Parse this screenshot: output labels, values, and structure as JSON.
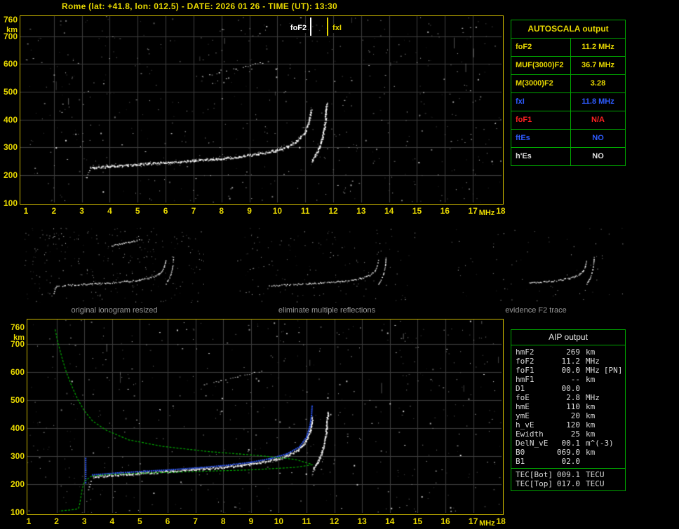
{
  "header": {
    "title": "Rome (lat: +41.8, lon: 012.5) - DATE: 2026 01 26 - TIME (UT): 13:30"
  },
  "colors": {
    "yellow": "#e8d800",
    "green_border": "#00a800",
    "blue": "#2e5bff",
    "red": "#ff2222",
    "white": "#e0e0e0",
    "profile_green": "#00b400",
    "caption_gray": "#9a9a9a"
  },
  "autoscala": {
    "title": "AUTOSCALA output",
    "rows": [
      {
        "label": "foF2",
        "value": "11.2 MHz",
        "color": "#e8d800"
      },
      {
        "label": "MUF(3000)F2",
        "value": "36.7 MHz",
        "color": "#e8d800"
      },
      {
        "label": "M(3000)F2",
        "value": "3.28",
        "color": "#e8d800"
      },
      {
        "label": "fxI",
        "value": "11.8 MHz",
        "color": "#2e5bff"
      },
      {
        "label": "foF1",
        "value": "N/A",
        "color": "#ff2222"
      },
      {
        "label": "ftEs",
        "value": "NO",
        "color": "#2e5bff"
      },
      {
        "label": "h'Es",
        "value": "NO",
        "color": "#e0e0e0"
      }
    ]
  },
  "aip": {
    "title": "AIP output",
    "rows": [
      {
        "name": "hmF2",
        "value": "269",
        "unit": "km"
      },
      {
        "name": "foF2",
        "value": "11.2",
        "unit": "MHz"
      },
      {
        "name": "foF1",
        "value": "00.0",
        "unit": "MHz",
        "note": "[PN]"
      },
      {
        "name": "hmF1",
        "value": "--",
        "unit": "km"
      },
      {
        "name": "D1",
        "value": "00.0",
        "unit": ""
      },
      {
        "name": "foE",
        "value": "2.8",
        "unit": "MHz"
      },
      {
        "name": "hmE",
        "value": "110",
        "unit": "km"
      },
      {
        "name": "ymE",
        "value": "20",
        "unit": "km"
      },
      {
        "name": "h_vE",
        "value": "120",
        "unit": "km"
      },
      {
        "name": "Ewidth",
        "value": "25",
        "unit": "km"
      },
      {
        "name": "DelN_vE",
        "value": "00.1",
        "unit": "m^(-3)"
      },
      {
        "name": "B0",
        "value": "069.0",
        "unit": "km"
      },
      {
        "name": "B1",
        "value": "02.0",
        "unit": ""
      }
    ],
    "tec_rows": [
      {
        "name": "TEC[Bot]",
        "value": "009.1",
        "unit": "TECU"
      },
      {
        "name": "TEC[Top]",
        "value": "017.0",
        "unit": "TECU"
      }
    ]
  },
  "thumbnails": [
    {
      "caption": "original ionogram resized"
    },
    {
      "caption": "eliminate multiple reflections"
    },
    {
      "caption": "evidence F2 trace"
    }
  ],
  "chart_data": [
    {
      "id": "ionogram_top",
      "type": "scatter",
      "title": "Recorded ionogram with AUTOSCALA frequency markers",
      "xlabel": "MHz",
      "ylabel": "km",
      "xlim": [
        1,
        18
      ],
      "ylim": [
        100,
        760
      ],
      "xticks": [
        1,
        2,
        3,
        4,
        5,
        6,
        7,
        8,
        9,
        10,
        11,
        12,
        13,
        14,
        15,
        16,
        17,
        18
      ],
      "yticks": [
        760,
        700,
        600,
        500,
        400,
        300,
        200,
        100
      ],
      "grid": true,
      "legend": "none",
      "markers": [
        {
          "label": "foF2",
          "x": 11.2,
          "color": "#ffffff",
          "side": "left"
        },
        {
          "label": "fxI",
          "x": 11.8,
          "color": "#e8d800",
          "side": "right"
        }
      ],
      "traces": [
        {
          "name": "F2 ordinary trace",
          "color": "#ffffff",
          "style": "fuzzy",
          "points": [
            [
              3.3,
              228
            ],
            [
              3.9,
              233
            ],
            [
              4.6,
              238
            ],
            [
              5.4,
              243
            ],
            [
              6.2,
              248
            ],
            [
              7.0,
              254
            ],
            [
              7.8,
              260
            ],
            [
              8.6,
              268
            ],
            [
              9.3,
              278
            ],
            [
              9.9,
              290
            ],
            [
              10.35,
              305
            ],
            [
              10.7,
              325
            ],
            [
              10.95,
              352
            ],
            [
              11.1,
              388
            ],
            [
              11.17,
              420
            ],
            [
              11.2,
              438
            ]
          ]
        },
        {
          "name": "F2 extraordinary trace",
          "color": "#ffffff",
          "style": "fuzzy",
          "points": [
            [
              11.22,
              250
            ],
            [
              11.35,
              272
            ],
            [
              11.48,
              298
            ],
            [
              11.58,
              330
            ],
            [
              11.66,
              366
            ],
            [
              11.71,
              402
            ],
            [
              11.74,
              440
            ],
            [
              11.75,
              458
            ]
          ]
        },
        {
          "name": "second hop reflection",
          "color": "#ffffff",
          "style": "dotted",
          "points": [
            [
              7.3,
              556
            ],
            [
              7.9,
              570
            ],
            [
              8.5,
              584
            ],
            [
              9.1,
              598
            ],
            [
              9.45,
              606
            ]
          ]
        },
        {
          "name": "fmin cluster",
          "color": "#ffffff",
          "style": "dotted",
          "points": [
            [
              3.1,
              172
            ],
            [
              3.16,
              192
            ],
            [
              3.22,
              210
            ],
            [
              3.3,
              226
            ]
          ]
        }
      ]
    },
    {
      "id": "ionogram_bottom",
      "type": "scatter",
      "title": "Ionogram with autoscaled trace and electron density profile",
      "xlabel": "MHz",
      "ylabel": "km",
      "xlim": [
        1,
        18
      ],
      "ylim": [
        100,
        760
      ],
      "xticks": [
        1,
        2,
        3,
        4,
        5,
        6,
        7,
        8,
        9,
        10,
        11,
        12,
        13,
        14,
        15,
        16,
        17,
        18
      ],
      "yticks": [
        760,
        700,
        600,
        500,
        400,
        300,
        200,
        100
      ],
      "grid": true,
      "legend": "none",
      "markers": [],
      "traces": [
        {
          "name": "F2 ordinary trace",
          "color": "#ffffff",
          "style": "fuzzy",
          "points": [
            [
              3.3,
              228
            ],
            [
              3.9,
              233
            ],
            [
              4.6,
              238
            ],
            [
              5.4,
              243
            ],
            [
              6.2,
              248
            ],
            [
              7.0,
              254
            ],
            [
              7.8,
              260
            ],
            [
              8.6,
              268
            ],
            [
              9.3,
              278
            ],
            [
              9.9,
              290
            ],
            [
              10.35,
              305
            ],
            [
              10.7,
              325
            ],
            [
              10.95,
              352
            ],
            [
              11.1,
              388
            ],
            [
              11.17,
              420
            ],
            [
              11.2,
              438
            ]
          ]
        },
        {
          "name": "F2 extraordinary trace",
          "color": "#ffffff",
          "style": "fuzzy",
          "points": [
            [
              11.22,
              250
            ],
            [
              11.35,
              272
            ],
            [
              11.48,
              298
            ],
            [
              11.58,
              330
            ],
            [
              11.66,
              366
            ],
            [
              11.71,
              402
            ],
            [
              11.74,
              440
            ],
            [
              11.75,
              458
            ]
          ]
        },
        {
          "name": "second hop reflection",
          "color": "#ffffff",
          "style": "dotted",
          "points": [
            [
              7.3,
              556
            ],
            [
              7.9,
              570
            ],
            [
              8.5,
              584
            ],
            [
              9.1,
              598
            ],
            [
              9.45,
              606
            ]
          ]
        },
        {
          "name": "fmin cluster",
          "color": "#ffffff",
          "style": "dotted",
          "points": [
            [
              3.1,
              172
            ],
            [
              3.16,
              192
            ],
            [
              3.22,
              210
            ],
            [
              3.3,
              226
            ]
          ]
        },
        {
          "name": "autoscaled trace start",
          "color": "#2e5bff",
          "style": "dots",
          "points": [
            [
              3.05,
              205
            ],
            [
              3.05,
              250
            ],
            [
              3.05,
              292
            ]
          ]
        },
        {
          "name": "autoscaled F2 trace",
          "color": "#2e5bff",
          "style": "dots",
          "points": [
            [
              3.3,
              233
            ],
            [
              4.2,
              240
            ],
            [
              5.2,
              246
            ],
            [
              6.2,
              252
            ],
            [
              7.2,
              259
            ],
            [
              8.2,
              268
            ],
            [
              9.0,
              278
            ],
            [
              9.7,
              291
            ],
            [
              10.3,
              308
            ],
            [
              10.75,
              333
            ],
            [
              11.0,
              368
            ],
            [
              11.12,
              405
            ],
            [
              11.18,
              445
            ],
            [
              11.2,
              478
            ]
          ]
        },
        {
          "name": "electron density profile",
          "color": "#00b400",
          "style": "line",
          "points": [
            [
              1.95,
              752
            ],
            [
              2.05,
              705
            ],
            [
              2.2,
              650
            ],
            [
              2.35,
              600
            ],
            [
              2.55,
              550
            ],
            [
              2.75,
              505
            ],
            [
              3.0,
              462
            ],
            [
              3.3,
              425
            ],
            [
              3.8,
              392
            ],
            [
              4.6,
              358
            ],
            [
              5.8,
              335
            ],
            [
              7.5,
              316
            ],
            [
              9.3,
              302
            ],
            [
              10.6,
              288
            ],
            [
              11.15,
              272
            ],
            [
              11.2,
              269
            ],
            [
              10.6,
              260
            ],
            [
              9.0,
              251
            ],
            [
              7.0,
              245
            ],
            [
              5.0,
              239
            ],
            [
              3.8,
              234
            ],
            [
              3.25,
              228
            ],
            [
              3.0,
              210
            ],
            [
              2.92,
              180
            ],
            [
              2.87,
              150
            ],
            [
              2.82,
              122
            ],
            [
              2.78,
              112
            ],
            [
              2.5,
              108
            ],
            [
              2.1,
              104
            ]
          ]
        }
      ]
    }
  ]
}
